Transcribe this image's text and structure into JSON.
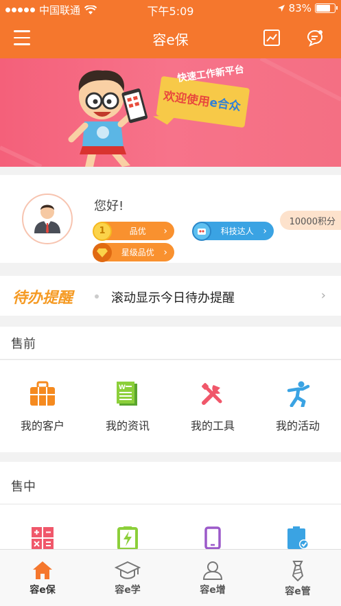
{
  "status_bar": {
    "carrier": "中国联通",
    "time": "下午5:09",
    "battery": "83%"
  },
  "nav": {
    "title": "容e保"
  },
  "banner": {
    "tagline": "快速工作新平台",
    "headline_prefix": "欢迎使用",
    "headline_brand": "e合众"
  },
  "user": {
    "greeting": "您好!",
    "badges": [
      {
        "label": "品优",
        "color": "#f9912f"
      },
      {
        "label": "科技达人",
        "color": "#3aa3e3"
      },
      {
        "label": "星级品优",
        "color": "#f9912f"
      }
    ],
    "points": "10000积分"
  },
  "todo": {
    "label": "待办提醒",
    "text": "滚动显示今日待办提醒"
  },
  "sections": [
    {
      "title": "售前",
      "items": [
        {
          "label": "我的客户",
          "icon": "briefcase-icon"
        },
        {
          "label": "我的资讯",
          "icon": "document-icon"
        },
        {
          "label": "我的工具",
          "icon": "tools-icon"
        },
        {
          "label": "我的活动",
          "icon": "runner-icon"
        }
      ]
    },
    {
      "title": "售中",
      "items": [
        {
          "label": "",
          "icon": "calculator-icon"
        },
        {
          "label": "",
          "icon": "battery-charge-icon"
        },
        {
          "label": "",
          "icon": "phone-icon"
        },
        {
          "label": "",
          "icon": "clipboard-check-icon"
        }
      ]
    }
  ],
  "tabs": [
    {
      "label": "容e保",
      "icon": "home-icon",
      "active": true
    },
    {
      "label": "容e学",
      "icon": "graduation-cap-icon",
      "active": false
    },
    {
      "label": "容e增",
      "icon": "user-icon",
      "active": false
    },
    {
      "label": "容e管",
      "icon": "tie-icon",
      "active": false
    }
  ],
  "colors": {
    "brand": "#f5772d",
    "accent_gold": "#f59a23",
    "banner": "#f4607a"
  }
}
